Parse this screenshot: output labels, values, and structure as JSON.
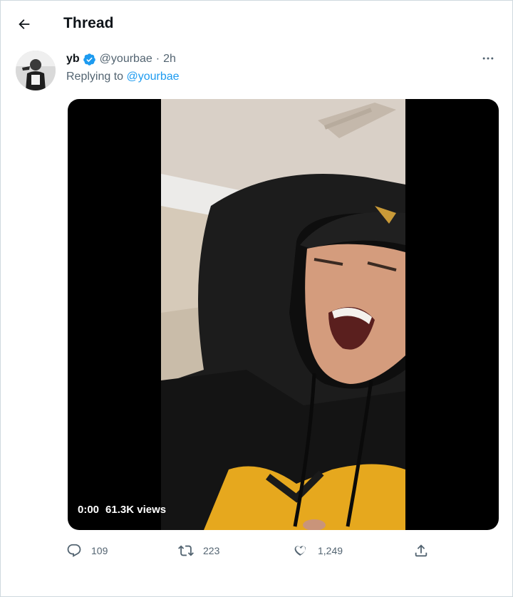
{
  "header": {
    "title": "Thread",
    "back_icon": "arrow-left-icon"
  },
  "tweet": {
    "author_name": "yb",
    "verified": true,
    "handle": "@yourbae",
    "separator": "·",
    "time": "2h",
    "replying_prefix": "Replying to ",
    "replying_to": "@yourbae",
    "video": {
      "current_time": "0:00",
      "views": "61.3K views"
    },
    "actions": {
      "replies": "109",
      "retweets": "223",
      "likes": "1,249"
    }
  },
  "colors": {
    "accent": "#1d9bf0",
    "muted_text": "#536471",
    "primary_text": "#0f1419",
    "hoodie_black": "#1a1a1a",
    "hoodie_yellow": "#e6a81e"
  }
}
